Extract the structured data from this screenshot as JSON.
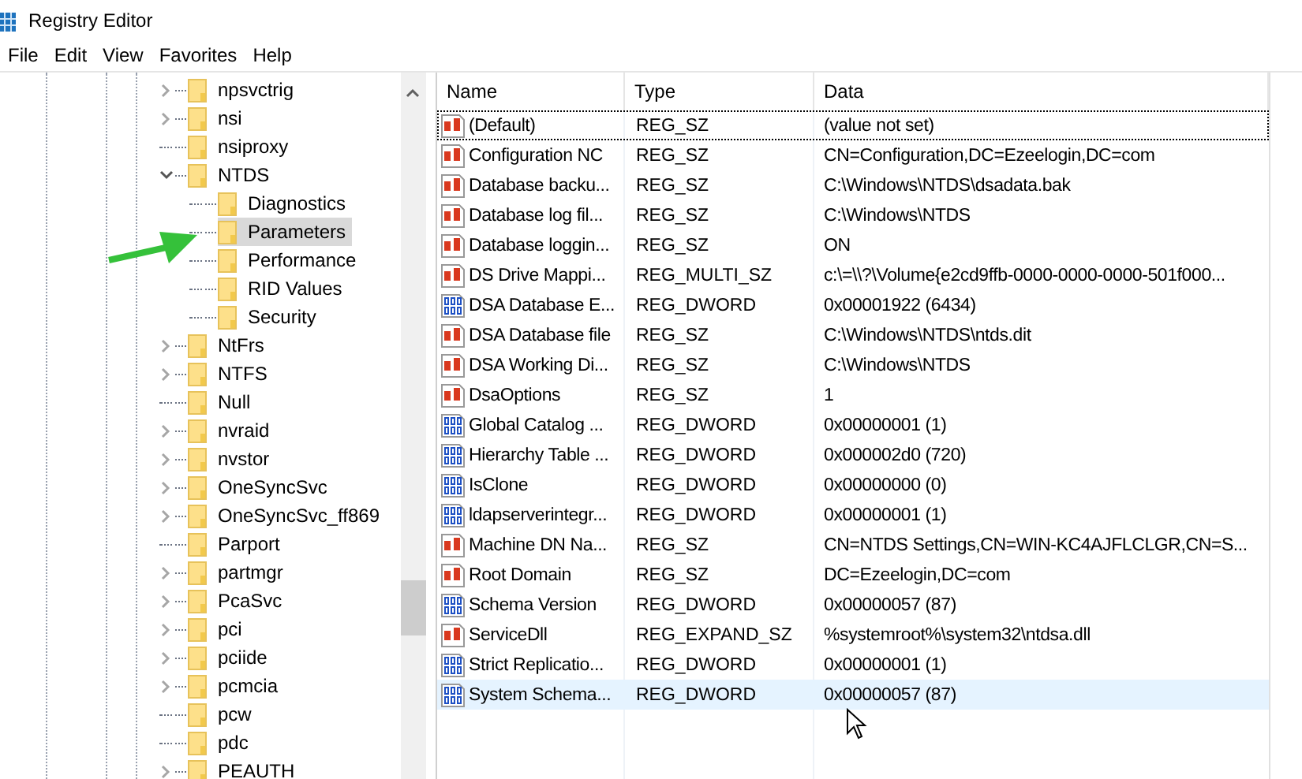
{
  "window": {
    "title": "Registry Editor"
  },
  "menu": [
    "File",
    "Edit",
    "View",
    "Favorites",
    "Help"
  ],
  "tree": [
    {
      "label": "npsvctrig",
      "has_children": true,
      "expanded": false,
      "selected": false
    },
    {
      "label": "nsi",
      "has_children": true,
      "expanded": false,
      "selected": false
    },
    {
      "label": "nsiproxy",
      "has_children": false,
      "selected": false
    },
    {
      "label": "NTDS",
      "has_children": true,
      "expanded": true,
      "selected": false,
      "children": [
        {
          "label": "Diagnostics",
          "has_children": false,
          "selected": false
        },
        {
          "label": "Parameters",
          "has_children": false,
          "selected": true
        },
        {
          "label": "Performance",
          "has_children": false,
          "selected": false
        },
        {
          "label": "RID Values",
          "has_children": false,
          "selected": false
        },
        {
          "label": "Security",
          "has_children": false,
          "selected": false
        }
      ]
    },
    {
      "label": "NtFrs",
      "has_children": true,
      "expanded": false,
      "selected": false
    },
    {
      "label": "NTFS",
      "has_children": true,
      "expanded": false,
      "selected": false
    },
    {
      "label": "Null",
      "has_children": false,
      "selected": false
    },
    {
      "label": "nvraid",
      "has_children": true,
      "expanded": false,
      "selected": false
    },
    {
      "label": "nvstor",
      "has_children": true,
      "expanded": false,
      "selected": false
    },
    {
      "label": "OneSyncSvc",
      "has_children": true,
      "expanded": false,
      "selected": false
    },
    {
      "label": "OneSyncSvc_ff869",
      "has_children": true,
      "expanded": false,
      "selected": false
    },
    {
      "label": "Parport",
      "has_children": false,
      "selected": false
    },
    {
      "label": "partmgr",
      "has_children": true,
      "expanded": false,
      "selected": false
    },
    {
      "label": "PcaSvc",
      "has_children": true,
      "expanded": false,
      "selected": false
    },
    {
      "label": "pci",
      "has_children": true,
      "expanded": false,
      "selected": false
    },
    {
      "label": "pciide",
      "has_children": true,
      "expanded": false,
      "selected": false
    },
    {
      "label": "pcmcia",
      "has_children": true,
      "expanded": false,
      "selected": false
    },
    {
      "label": "pcw",
      "has_children": false,
      "selected": false
    },
    {
      "label": "pdc",
      "has_children": false,
      "selected": false
    },
    {
      "label": "PEAUTH",
      "has_children": true,
      "expanded": false,
      "selected": false
    }
  ],
  "table": {
    "columns": [
      "Name",
      "Type",
      "Data"
    ],
    "rows": [
      {
        "kind": "string",
        "name": "(Default)",
        "type": "REG_SZ",
        "data": "(value not set)",
        "focused": true,
        "selected": false
      },
      {
        "kind": "string",
        "name": "Configuration NC",
        "type": "REG_SZ",
        "data": "CN=Configuration,DC=Ezeelogin,DC=com",
        "focused": false,
        "selected": false
      },
      {
        "kind": "string",
        "name": "Database backu...",
        "type": "REG_SZ",
        "data": "C:\\Windows\\NTDS\\dsadata.bak",
        "focused": false,
        "selected": false
      },
      {
        "kind": "string",
        "name": "Database log fil...",
        "type": "REG_SZ",
        "data": "C:\\Windows\\NTDS",
        "focused": false,
        "selected": false
      },
      {
        "kind": "string",
        "name": "Database loggin...",
        "type": "REG_SZ",
        "data": "ON",
        "focused": false,
        "selected": false
      },
      {
        "kind": "string",
        "name": "DS Drive Mappi...",
        "type": "REG_MULTI_SZ",
        "data": "c:\\=\\\\?\\Volume{e2cd9ffb-0000-0000-0000-501f000...",
        "focused": false,
        "selected": false
      },
      {
        "kind": "binary",
        "name": "DSA Database E...",
        "type": "REG_DWORD",
        "data": "0x00001922 (6434)",
        "focused": false,
        "selected": false
      },
      {
        "kind": "string",
        "name": "DSA Database file",
        "type": "REG_SZ",
        "data": "C:\\Windows\\NTDS\\ntds.dit",
        "focused": false,
        "selected": false
      },
      {
        "kind": "string",
        "name": "DSA Working Di...",
        "type": "REG_SZ",
        "data": "C:\\Windows\\NTDS",
        "focused": false,
        "selected": false
      },
      {
        "kind": "string",
        "name": "DsaOptions",
        "type": "REG_SZ",
        "data": "1",
        "focused": false,
        "selected": false
      },
      {
        "kind": "binary",
        "name": "Global Catalog ...",
        "type": "REG_DWORD",
        "data": "0x00000001 (1)",
        "focused": false,
        "selected": false
      },
      {
        "kind": "binary",
        "name": "Hierarchy Table ...",
        "type": "REG_DWORD",
        "data": "0x000002d0 (720)",
        "focused": false,
        "selected": false
      },
      {
        "kind": "binary",
        "name": "IsClone",
        "type": "REG_DWORD",
        "data": "0x00000000 (0)",
        "focused": false,
        "selected": false
      },
      {
        "kind": "binary",
        "name": "ldapserverintegr...",
        "type": "REG_DWORD",
        "data": "0x00000001 (1)",
        "focused": false,
        "selected": false
      },
      {
        "kind": "string",
        "name": "Machine DN Na...",
        "type": "REG_SZ",
        "data": "CN=NTDS Settings,CN=WIN-KC4AJFLCLGR,CN=S...",
        "focused": false,
        "selected": false
      },
      {
        "kind": "string",
        "name": "Root Domain",
        "type": "REG_SZ",
        "data": "DC=Ezeelogin,DC=com",
        "focused": false,
        "selected": false
      },
      {
        "kind": "binary",
        "name": "Schema Version",
        "type": "REG_DWORD",
        "data": "0x00000057 (87)",
        "focused": false,
        "selected": false
      },
      {
        "kind": "string",
        "name": "ServiceDll",
        "type": "REG_EXPAND_SZ",
        "data": "%systemroot%\\system32\\ntdsa.dll",
        "focused": false,
        "selected": false
      },
      {
        "kind": "binary",
        "name": "Strict Replicatio...",
        "type": "REG_DWORD",
        "data": "0x00000001 (1)",
        "focused": false,
        "selected": false
      },
      {
        "kind": "binary",
        "name": "System Schema...",
        "type": "REG_DWORD",
        "data": "0x00000057 (87)",
        "focused": false,
        "selected": true
      }
    ]
  }
}
